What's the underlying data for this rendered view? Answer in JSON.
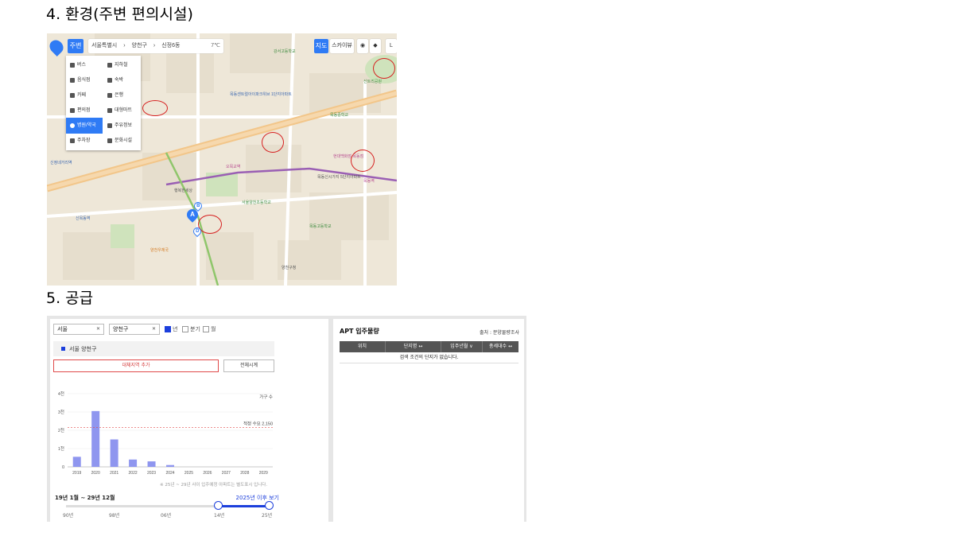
{
  "headings": {
    "environment": "4. 환경(주변 편의시설)",
    "supply": "5. 공급"
  },
  "map": {
    "topbar": {
      "nearby_label": "주변",
      "address_parts": [
        "서울특별시",
        "양천구",
        "신정6동"
      ],
      "weather": "7℃",
      "map_label": "지도",
      "skyview_label": "스카이뷰"
    },
    "poi_menu": [
      {
        "label": "버스",
        "icon": "bus-icon"
      },
      {
        "label": "지하철",
        "icon": "subway-icon"
      },
      {
        "label": "음식점",
        "icon": "restaurant-icon"
      },
      {
        "label": "숙박",
        "icon": "bed-icon"
      },
      {
        "label": "카페",
        "icon": "cafe-icon"
      },
      {
        "label": "은행",
        "icon": "bank-icon"
      },
      {
        "label": "편의점",
        "icon": "store-icon"
      },
      {
        "label": "대형마트",
        "icon": "cart-icon"
      },
      {
        "label": "병원/약국",
        "icon": "hospital-icon"
      },
      {
        "label": "주유정보",
        "icon": "fuel-icon"
      },
      {
        "label": "주차장",
        "icon": "parking-icon"
      },
      {
        "label": "문화시설",
        "icon": "culture-icon"
      }
    ],
    "labels": [
      "목동센트럴아이파크위브 1단지아파트",
      "목동중학교",
      "강서고등학교",
      "목동신시가지 5단지아파트",
      "양천구청",
      "목동역",
      "오목교역",
      "신정네거리역",
      "서울양천초등학교",
      "신트리공원",
      "현대백화점 목동점",
      "행복한세상",
      "목동고등학교",
      "양천우체국",
      "신목동역"
    ]
  },
  "supply": {
    "city_select": "서울",
    "district_select": "양천구",
    "period_options": [
      "년",
      "분기",
      "월"
    ],
    "region_label": "서울 양천구",
    "add_region_button": "대체지역 추가",
    "all_view_button": "전체시계",
    "chart_unit": "가구 수",
    "threshold_label": "적정 수요 2,150",
    "note": "※ 25년 ~ 29년 사이 입주예정 아파트는 별도표시 입니다.",
    "range_label": "19년 1월 ~ 29년 12월",
    "after_link": "2025년 이후 보기",
    "slider_ticks": [
      "90년",
      "98년",
      "06년",
      "14년",
      "25년"
    ],
    "apt_title": "APT 입주물량",
    "source": "출처 : 분양물량조사",
    "table_headers": [
      "위치",
      "단지명 ↔",
      "입주년월 ∨",
      "총세대수 ↔"
    ],
    "empty_message": "검색 조건의 단지가 없습니다."
  },
  "chart_data": {
    "type": "bar",
    "categories": [
      "2019",
      "2020",
      "2021",
      "2022",
      "2023",
      "2024",
      "2025",
      "2026",
      "2027",
      "2028",
      "2029"
    ],
    "values": [
      550,
      3050,
      1500,
      400,
      300,
      100,
      0,
      0,
      0,
      0,
      0
    ],
    "ylim": [
      0,
      4000
    ],
    "yticks": [
      "0",
      "1천",
      "2천",
      "3천",
      "4천"
    ],
    "threshold": 2150,
    "bar_color": "#8f96ef",
    "threshold_color": "#e24b4b"
  }
}
